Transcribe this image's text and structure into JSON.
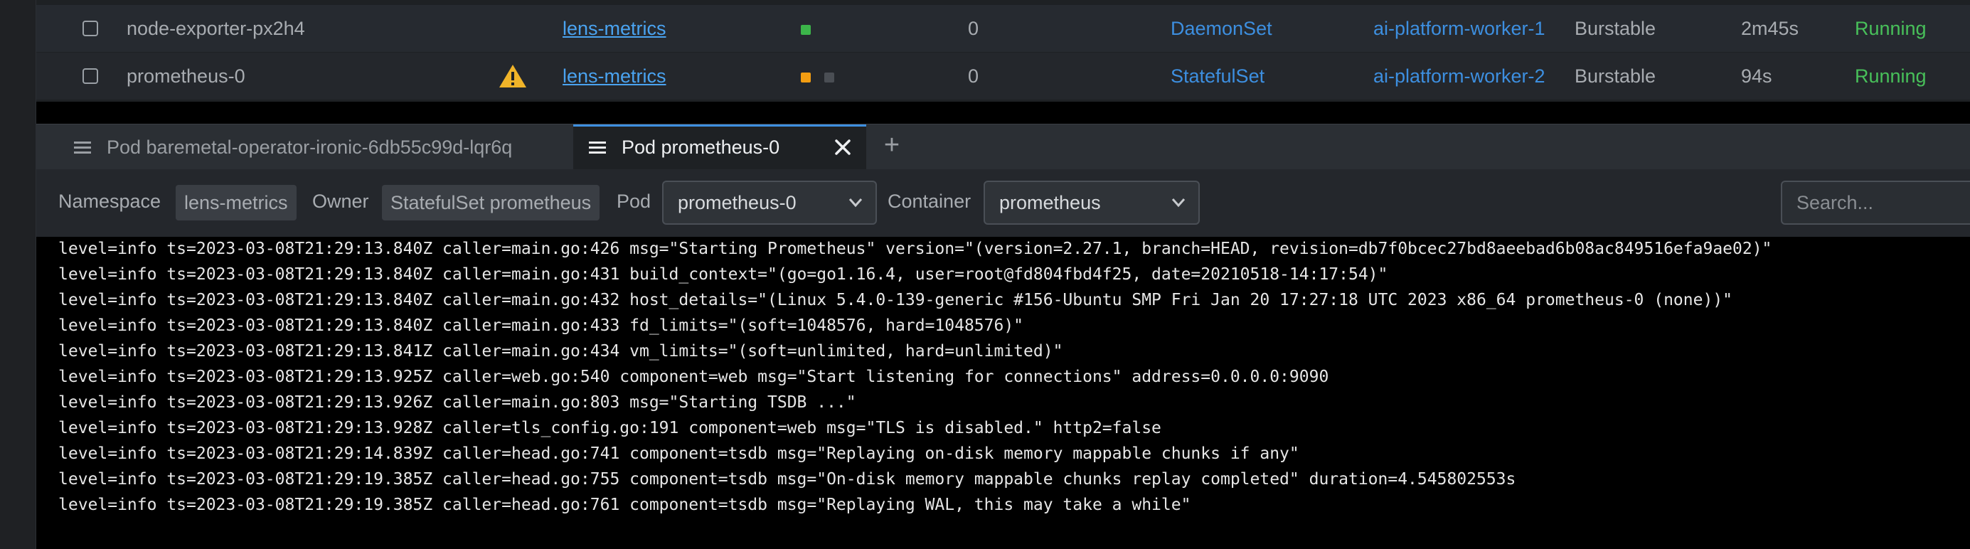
{
  "rows": [
    {
      "name": "node-exporter-px2h4",
      "warning": false,
      "namespace": "lens-metrics",
      "containers": [
        "#3cb54a"
      ],
      "restarts": "0",
      "controlled_by": "DaemonSet",
      "node": "ai-platform-worker-1",
      "qos": "Burstable",
      "age": "2m45s",
      "status": "Running"
    },
    {
      "name": "prometheus-0",
      "warning": true,
      "namespace": "lens-metrics",
      "containers": [
        "#f29d12",
        "#4a4e54"
      ],
      "restarts": "0",
      "controlled_by": "StatefulSet",
      "node": "ai-platform-worker-2",
      "qos": "Burstable",
      "age": "94s",
      "status": "Running"
    }
  ],
  "tabs": [
    {
      "label": "Pod baremetal-operator-ironic-6db55c99d-lqr6q",
      "active": false,
      "icon": "logs-icon"
    },
    {
      "label": "Pod prometheus-0",
      "active": true,
      "icon": "logs-icon",
      "closable": true
    }
  ],
  "new_tab_label": "+",
  "controls": {
    "namespace_label": "Namespace",
    "namespace_value": "lens-metrics",
    "owner_label": "Owner",
    "owner_value": "StatefulSet prometheus",
    "pod_label": "Pod",
    "pod_value": "prometheus-0",
    "container_label": "Container",
    "container_value": "prometheus",
    "search_placeholder": "Search..."
  },
  "logs": [
    "level=info ts=2023-03-08T21:29:13.840Z caller=main.go:426 msg=\"Starting Prometheus\" version=\"(version=2.27.1, branch=HEAD, revision=db7f0bcec27bd8aeebad6b08ac849516efa9ae02)\"",
    "level=info ts=2023-03-08T21:29:13.840Z caller=main.go:431 build_context=\"(go=go1.16.4, user=root@fd804fbd4f25, date=20210518-14:17:54)\"",
    "level=info ts=2023-03-08T21:29:13.840Z caller=main.go:432 host_details=\"(Linux 5.4.0-139-generic #156-Ubuntu SMP Fri Jan 20 17:27:18 UTC 2023 x86_64 prometheus-0 (none))\"",
    "level=info ts=2023-03-08T21:29:13.840Z caller=main.go:433 fd_limits=\"(soft=1048576, hard=1048576)\"",
    "level=info ts=2023-03-08T21:29:13.841Z caller=main.go:434 vm_limits=\"(soft=unlimited, hard=unlimited)\"",
    "level=info ts=2023-03-08T21:29:13.925Z caller=web.go:540 component=web msg=\"Start listening for connections\" address=0.0.0.0:9090",
    "level=info ts=2023-03-08T21:29:13.926Z caller=main.go:803 msg=\"Starting TSDB ...\"",
    "level=info ts=2023-03-08T21:29:13.928Z caller=tls_config.go:191 component=web msg=\"TLS is disabled.\" http2=false",
    "level=info ts=2023-03-08T21:29:14.839Z caller=head.go:741 component=tsdb msg=\"Replaying on-disk memory mappable chunks if any\"",
    "level=info ts=2023-03-08T21:29:19.385Z caller=head.go:755 component=tsdb msg=\"On-disk memory mappable chunks replay completed\" duration=4.545802553s",
    "level=info ts=2023-03-08T21:29:19.385Z caller=head.go:761 component=tsdb msg=\"Replaying WAL, this may take a while\""
  ],
  "colors": {
    "accent": "#3d8fe0",
    "running": "#48c05a",
    "warning": "#f0b429"
  }
}
